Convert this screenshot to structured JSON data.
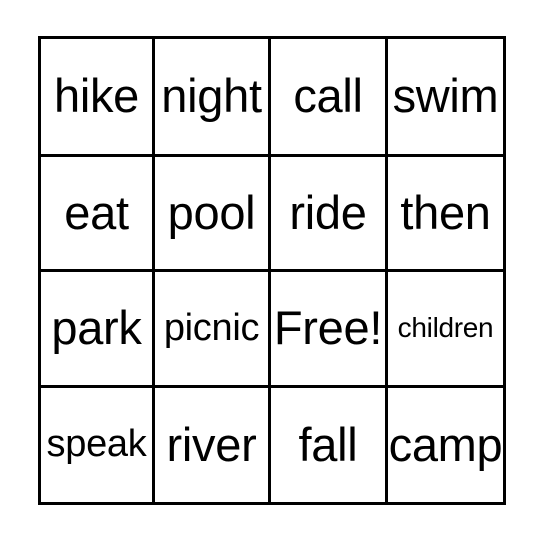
{
  "card": {
    "type": "bingo-card",
    "columns": 4,
    "rows": 4,
    "border_color": "#000000",
    "background_color": "#ffffff",
    "text_color": "#000000",
    "free_space": {
      "row": 2,
      "column": 2,
      "label": "Free!"
    },
    "grid": [
      [
        {
          "label": "hike",
          "size": "lg"
        },
        {
          "label": "night",
          "size": "lg"
        },
        {
          "label": "call",
          "size": "lg"
        },
        {
          "label": "swim",
          "size": "lg"
        }
      ],
      [
        {
          "label": "eat",
          "size": "lg"
        },
        {
          "label": "pool",
          "size": "lg"
        },
        {
          "label": "ride",
          "size": "lg"
        },
        {
          "label": "then",
          "size": "lg"
        }
      ],
      [
        {
          "label": "park",
          "size": "lg"
        },
        {
          "label": "picnic",
          "size": "md"
        },
        {
          "label": "Free!",
          "size": "lg"
        },
        {
          "label": "children",
          "size": "sm"
        }
      ],
      [
        {
          "label": "speak",
          "size": "md"
        },
        {
          "label": "river",
          "size": "lg"
        },
        {
          "label": "fall",
          "size": "lg"
        },
        {
          "label": "camp",
          "size": "lg"
        }
      ]
    ]
  }
}
